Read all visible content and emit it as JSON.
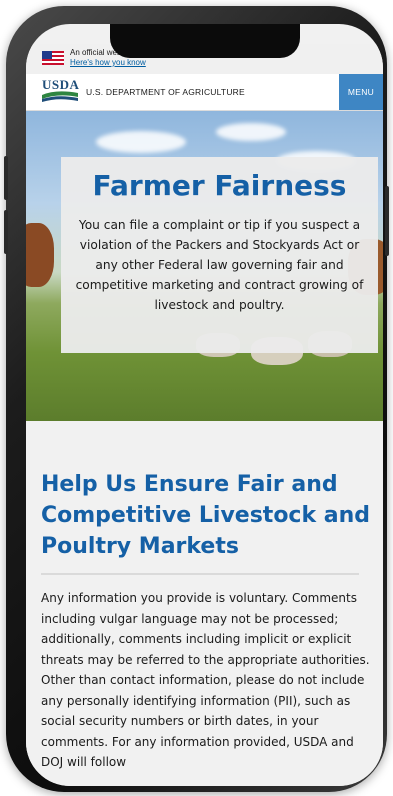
{
  "banner": {
    "text": "An official website of the United States government",
    "link": "Here's how you know"
  },
  "header": {
    "logo_text": "USDA",
    "department": "U.S. DEPARTMENT OF AGRICULTURE",
    "menu_label": "MENU"
  },
  "hero": {
    "title": "Farmer Fairness",
    "text": "You can file a complaint or tip if you suspect a violation of the Packers and Stockyards Act or any other Federal law governing fair and competitive marketing and contract growing of livestock and poultry."
  },
  "main": {
    "section_title": "Help Us Ensure Fair and Competitive Livestock and Poultry Markets",
    "body": "Any information you provide is voluntary. Comments including vulgar language may not be processed; additionally, comments including implicit or explicit threats may be referred to the appropriate authorities. Other than contact information, please do not include any personally identifying information (PII), such as social security numbers or birth dates, in your comments. For any information provided, USDA and DOJ will follow"
  },
  "colors": {
    "brand_blue": "#1560a6",
    "menu_blue": "#3e86c4",
    "usda_navy": "#1f4e79",
    "usda_green": "#2e8540"
  }
}
